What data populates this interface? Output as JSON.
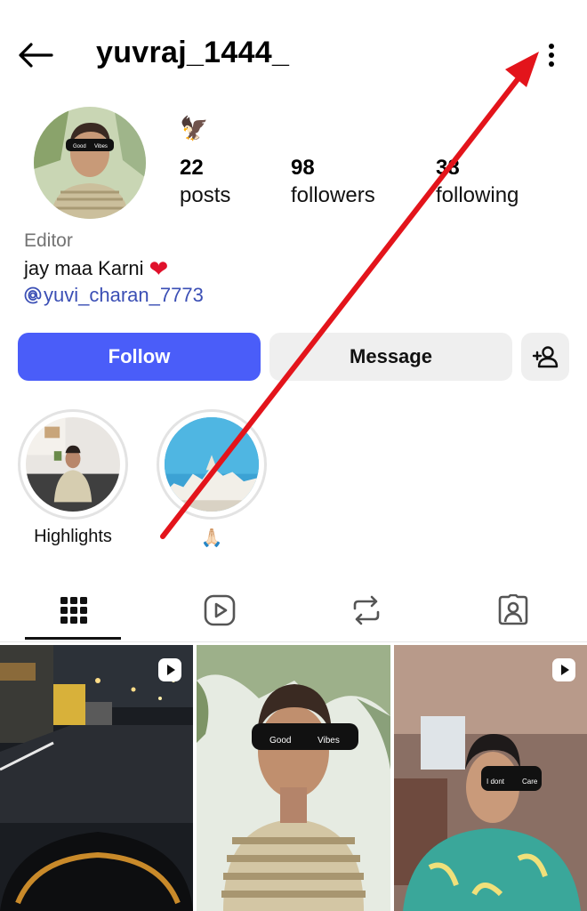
{
  "header": {
    "username": "yuvraj_1444_",
    "back_icon": "arrow-left-icon",
    "more_icon": "more-vertical-icon"
  },
  "profile": {
    "avatar_glasses_text_left": "Good",
    "avatar_glasses_text_right": "Vibes",
    "emoji": "🦅",
    "stats": [
      {
        "value": "22",
        "label": "posts"
      },
      {
        "value": "98",
        "label": "followers"
      },
      {
        "value": "38",
        "label": "following"
      }
    ],
    "category": "Editor",
    "bio": "jay maa Karni",
    "bio_emoji": "❤",
    "mention": "yuvi_charan_7773"
  },
  "actions": {
    "follow_label": "Follow",
    "message_label": "Message",
    "add_user_icon": "add-user-icon"
  },
  "highlights": [
    {
      "label": "Highlights"
    },
    {
      "label": "🙏🏻"
    }
  ],
  "tabs": [
    {
      "name": "grid",
      "icon": "grid-icon",
      "active": true
    },
    {
      "name": "reels",
      "icon": "reels-icon",
      "active": false
    },
    {
      "name": "reposts",
      "icon": "repost-icon",
      "active": false
    },
    {
      "name": "tagged",
      "icon": "tagged-icon",
      "active": false
    }
  ],
  "posts": [
    {
      "type": "reel",
      "glasses_left": "",
      "glasses_right": ""
    },
    {
      "type": "photo",
      "glasses_left": "Good",
      "glasses_right": "Vibes"
    },
    {
      "type": "reel",
      "glasses_left": "I dont",
      "glasses_right": "Care"
    }
  ],
  "colors": {
    "follow_blue": "#4a5df9",
    "secondary_gray": "#efefef",
    "mention_blue": "#3b4fb5",
    "annotation_red": "#e3141b"
  }
}
